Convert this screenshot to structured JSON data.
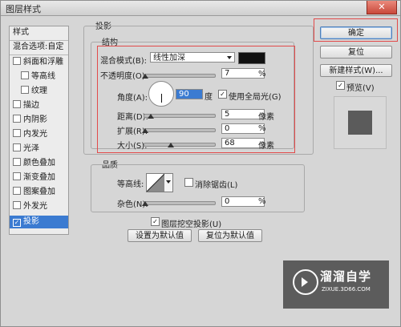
{
  "window": {
    "title": "图层样式"
  },
  "sidebar": {
    "items": [
      {
        "label": "样式",
        "checkbox": false,
        "checked": false,
        "indent": false,
        "selected": false
      },
      {
        "label": "混合选项:自定",
        "checkbox": false,
        "checked": false,
        "indent": false,
        "selected": false
      },
      {
        "label": "斜面和浮雕",
        "checkbox": true,
        "checked": false,
        "indent": false,
        "selected": false
      },
      {
        "label": "等高线",
        "checkbox": true,
        "checked": false,
        "indent": true,
        "selected": false
      },
      {
        "label": "纹理",
        "checkbox": true,
        "checked": false,
        "indent": true,
        "selected": false
      },
      {
        "label": "描边",
        "checkbox": true,
        "checked": false,
        "indent": false,
        "selected": false
      },
      {
        "label": "内阴影",
        "checkbox": true,
        "checked": false,
        "indent": false,
        "selected": false
      },
      {
        "label": "内发光",
        "checkbox": true,
        "checked": false,
        "indent": false,
        "selected": false
      },
      {
        "label": "光泽",
        "checkbox": true,
        "checked": false,
        "indent": false,
        "selected": false
      },
      {
        "label": "颜色叠加",
        "checkbox": true,
        "checked": false,
        "indent": false,
        "selected": false
      },
      {
        "label": "渐变叠加",
        "checkbox": true,
        "checked": false,
        "indent": false,
        "selected": false
      },
      {
        "label": "图案叠加",
        "checkbox": true,
        "checked": false,
        "indent": false,
        "selected": false
      },
      {
        "label": "外发光",
        "checkbox": true,
        "checked": false,
        "indent": false,
        "selected": false
      },
      {
        "label": "投影",
        "checkbox": true,
        "checked": true,
        "indent": false,
        "selected": true
      }
    ]
  },
  "drop_shadow": {
    "section_title": "投影",
    "structure": {
      "title": "结构",
      "blend_mode_label": "混合模式(B):",
      "blend_mode_value": "线性加深",
      "color": "#111111",
      "opacity_label": "不透明度(O):",
      "opacity_value": "7",
      "opacity_unit": "%",
      "angle_label": "角度(A):",
      "angle_value": "90",
      "angle_unit": "度",
      "global_light_label": "使用全局光(G)",
      "global_light_checked": true,
      "distance_label": "距离(D):",
      "distance_value": "5",
      "distance_unit": "像素",
      "spread_label": "扩展(R):",
      "spread_value": "0",
      "spread_unit": "%",
      "size_label": "大小(S):",
      "size_value": "68",
      "size_unit": "像素"
    },
    "quality": {
      "title": "品质",
      "contour_label": "等高线:",
      "antialias_label": "消除锯齿(L)",
      "antialias_checked": false,
      "noise_label": "杂色(N):",
      "noise_value": "0",
      "noise_unit": "%"
    },
    "knockout_label": "图层挖空投影(U)",
    "knockout_checked": true,
    "set_default_label": "设置为默认值",
    "reset_default_label": "复位为默认值"
  },
  "actions": {
    "ok_label": "确定",
    "reset_label": "复位",
    "new_style_label": "新建样式(W)...",
    "preview_label": "预览(V)",
    "preview_checked": true
  },
  "watermark": {
    "title": "溜溜自学",
    "subtitle": "ZIXUE.3D66.COM"
  },
  "close_glyph": "✕",
  "check_glyph": "✓"
}
